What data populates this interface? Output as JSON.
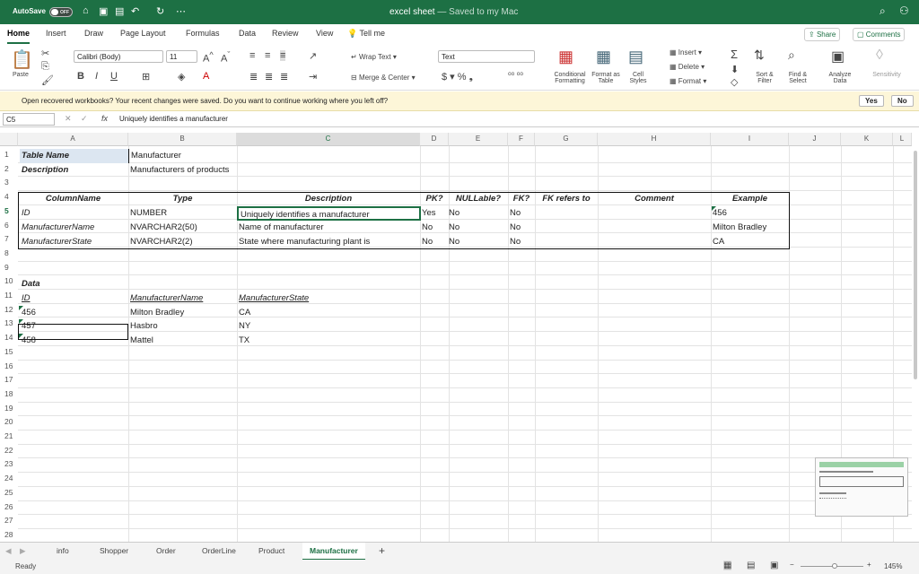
{
  "app": {
    "autosave": "AutoSave",
    "autosave_state": "OFF",
    "title": "excel sheet",
    "title_sub": "— Saved to my Mac"
  },
  "tabs": [
    "Home",
    "Insert",
    "Draw",
    "Page Layout",
    "Formulas",
    "Data",
    "Review",
    "View",
    "Tell me"
  ],
  "share": "Share",
  "comments": "Comments",
  "ribbon": {
    "paste": "Paste",
    "font": "Calibri (Body)",
    "size": "11",
    "wrap": "Wrap Text",
    "merge": "Merge & Center",
    "numfmt": "Text",
    "cond": "Conditional Formatting",
    "fmt_table": "Format as Table",
    "cell_styles": "Cell Styles",
    "insert": "Insert",
    "delete": "Delete",
    "format": "Format",
    "sort": "Sort & Filter",
    "find": "Find & Select",
    "analyze": "Analyze Data",
    "sensitivity": "Sensitivity"
  },
  "message": {
    "text": "Open recovered workbooks?  Your recent changes were saved. Do you want to continue working where you left off?",
    "yes": "Yes",
    "no": "No"
  },
  "formula": {
    "namebox": "C5",
    "fx": "fx",
    "value": "Uniquely identifies a manufacturer"
  },
  "columns": [
    "A",
    "B",
    "C",
    "D",
    "E",
    "F",
    "G",
    "H",
    "I",
    "J",
    "K",
    "L"
  ],
  "rows": [
    "1",
    "2",
    "3",
    "4",
    "5",
    "6",
    "7",
    "8",
    "9",
    "10",
    "11",
    "12",
    "13",
    "14",
    "15",
    "16",
    "17",
    "18",
    "19",
    "20",
    "21",
    "22",
    "23",
    "24",
    "25",
    "26",
    "27",
    "28"
  ],
  "cells": {
    "r1": {
      "a": "Table Name",
      "b": "Manufacturer"
    },
    "r2": {
      "a": "Description",
      "b": "Manufacturers of products"
    },
    "hdr": {
      "a": "ColumnName",
      "b": "Type",
      "c": "Description",
      "d": "PK?",
      "e": "NULLable?",
      "f": "FK?",
      "g": "FK refers to",
      "h": "Comment",
      "i": "Example"
    },
    "r5": {
      "a": "ID",
      "b": "NUMBER",
      "c": "Uniquely identifies a manufacturer",
      "d": "Yes",
      "e": "No",
      "f": "No",
      "i": "456"
    },
    "r6": {
      "a": "ManufacturerName",
      "b": "NVARCHAR2(50)",
      "c": "Name of manufacturer",
      "d": "No",
      "e": "No",
      "f": "No",
      "i": "Milton Bradley"
    },
    "r7": {
      "a": "ManufacturerState",
      "b": "NVARCHAR2(2)",
      "c": "State where manufacturing plant is",
      "d": "No",
      "e": "No",
      "f": "No",
      "i": "CA"
    },
    "r10": {
      "a": "Data"
    },
    "r11": {
      "a": "ID",
      "b": "ManufacturerName",
      "c": "ManufacturerState"
    },
    "r12": {
      "a": "456",
      "b": "Milton Bradley",
      "c": "CA"
    },
    "r13": {
      "a": "457",
      "b": "Hasbro",
      "c": "NY"
    },
    "r14": {
      "a": "458",
      "b": "Mattel",
      "c": "TX"
    }
  },
  "sheets": [
    "info",
    "Shopper",
    "Order",
    "OrderLine",
    "Product",
    "Manufacturer"
  ],
  "status": {
    "ready": "Ready",
    "zoom": "145%"
  }
}
